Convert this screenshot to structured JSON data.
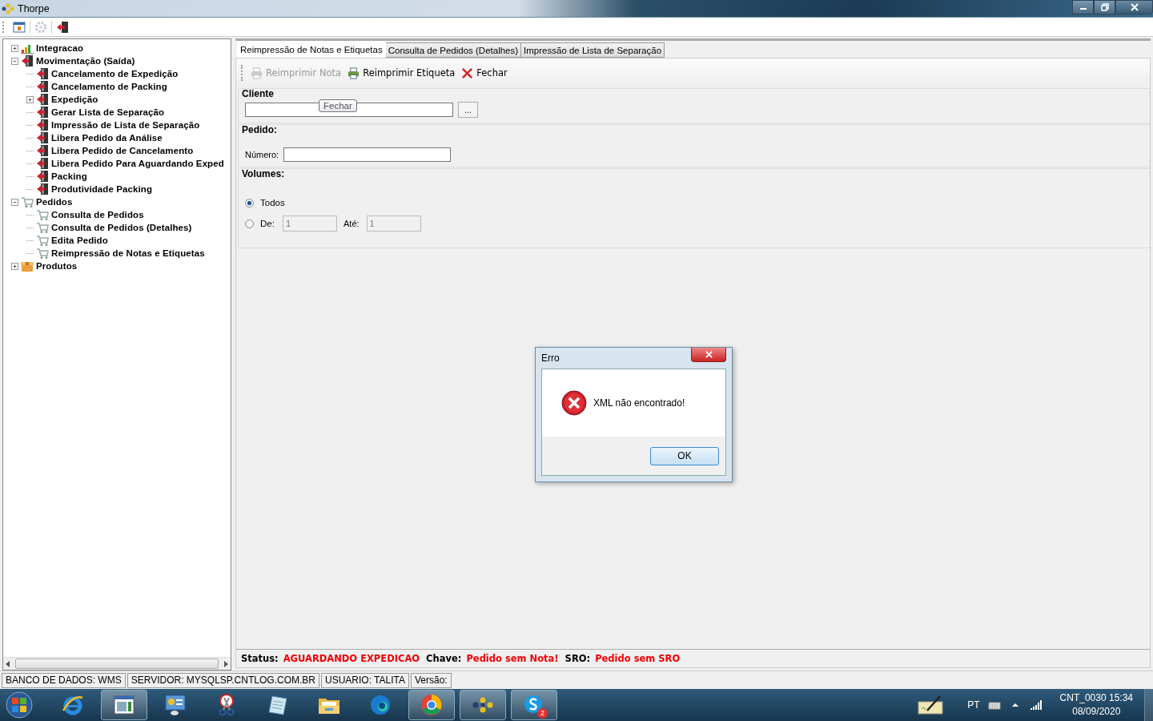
{
  "window": {
    "title": "Thorpe"
  },
  "toolbar": [
    {
      "kind": "panel",
      "disabled": false
    },
    {
      "kind": "gear",
      "disabled": true
    },
    {
      "kind": "exit",
      "disabled": false
    }
  ],
  "tree": [
    {
      "label": "Integracao",
      "kind": "chart",
      "expanded": false
    },
    {
      "label": "Movimentação (Saída)",
      "kind": "door",
      "expanded": true,
      "children": [
        {
          "label": "Cancelamento de Expedição",
          "kind": "door"
        },
        {
          "label": "Cancelamento de Packing",
          "kind": "door"
        },
        {
          "label": "Expedição",
          "kind": "door",
          "expanded": false
        },
        {
          "label": "Gerar Lista de Separação",
          "kind": "door"
        },
        {
          "label": "Impressão de Lista de Separação",
          "kind": "door"
        },
        {
          "label": "Libera Pedido da Análise",
          "kind": "door"
        },
        {
          "label": "Libera Pedido de Cancelamento",
          "kind": "door"
        },
        {
          "label": "Libera Pedido Para Aguardando Exped",
          "kind": "door"
        },
        {
          "label": "Packing",
          "kind": "door"
        },
        {
          "label": "Produtividade Packing",
          "kind": "door"
        }
      ]
    },
    {
      "label": "Pedidos",
      "kind": "cart",
      "expanded": true,
      "children": [
        {
          "label": "Consulta de Pedidos",
          "kind": "cart"
        },
        {
          "label": "Consulta de Pedidos (Detalhes)",
          "kind": "cart"
        },
        {
          "label": "Edita Pedido",
          "kind": "cart"
        },
        {
          "label": "Reimpressão de Notas e Etiquetas",
          "kind": "cart"
        }
      ]
    },
    {
      "label": "Produtos",
      "kind": "box",
      "expanded": false
    }
  ],
  "tabs": [
    {
      "label": "Reimpressão de Notas e Etiquetas",
      "selected": true
    },
    {
      "label": "Consulta de Pedidos (Detalhes)",
      "selected": false
    },
    {
      "label": "Impressão de Lista de Separação",
      "selected": false
    }
  ],
  "actions": [
    {
      "label": "Reimprimir Nota",
      "kind": "print",
      "disabled": true
    },
    {
      "label": "Reimprimir Etiqueta",
      "kind": "print",
      "disabled": false
    },
    {
      "label": "Fechar",
      "kind": "close",
      "disabled": false
    }
  ],
  "cliente": {
    "title": "Cliente",
    "browse": "...",
    "tooltip": "Fechar"
  },
  "pedido": {
    "title": "Pedido:",
    "label": "Número:"
  },
  "volumes": {
    "title": "Volumes:",
    "options": [
      {
        "label": "Todos",
        "selected": true
      },
      {
        "label": "De:",
        "selected": false
      }
    ],
    "from": {
      "value": "1",
      "disabled": true
    },
    "to_label": "Até:",
    "to": {
      "value": "1",
      "disabled": true
    }
  },
  "status_line": [
    {
      "label": "Status:",
      "value": "AGUARDANDO EXPEDICAO"
    },
    {
      "label": "Chave:",
      "value": "Pedido sem Nota!"
    },
    {
      "label": "SRO:",
      "value": "Pedido sem SRO"
    }
  ],
  "status_bar": [
    "BANCO DE DADOS: WMS",
    "SERVIDOR: MYSQLSP.CNTLOG.COM.BR",
    "USUARIO: TALITA",
    "Versão:"
  ],
  "dialog": {
    "title": "Erro",
    "message": "XML não encontrado!",
    "button": "OK"
  },
  "taskbar": [
    {
      "kind": "ie",
      "running": false
    },
    {
      "kind": "window",
      "running": true
    },
    {
      "kind": "control",
      "running": false
    },
    {
      "kind": "snip",
      "running": false
    },
    {
      "kind": "notepad",
      "running": false
    },
    {
      "kind": "folder",
      "running": false
    },
    {
      "kind": "edge",
      "running": false
    },
    {
      "kind": "chrome",
      "running": true
    },
    {
      "kind": "dots",
      "running": true
    },
    {
      "kind": "skype",
      "running": true,
      "badge": "2"
    }
  ],
  "tray": {
    "language": "PT",
    "clock": "CNT_0030 15:34",
    "date": "08/09/2020"
  }
}
